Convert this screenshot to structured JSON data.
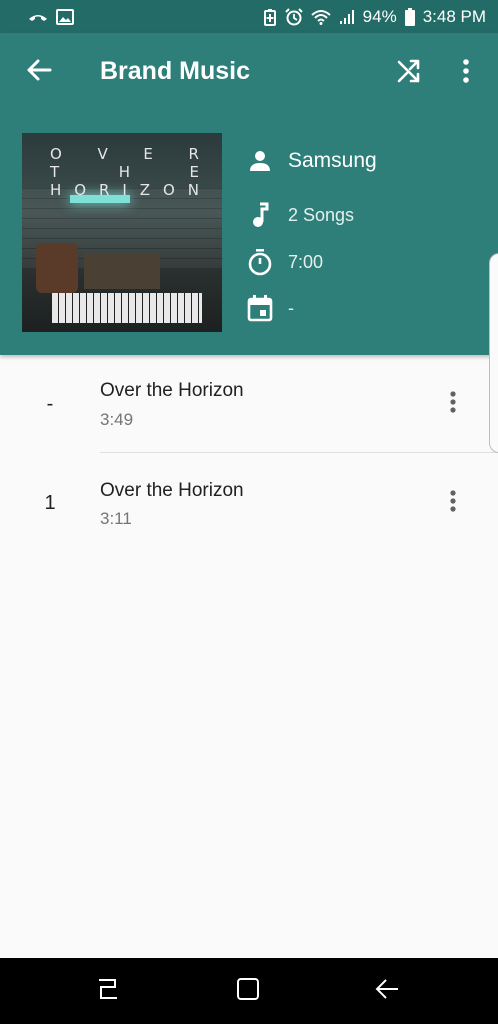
{
  "status_bar": {
    "battery_percent": "94%",
    "time": "3:48 PM",
    "left_icons": [
      "missed-call-icon",
      "image-icon"
    ],
    "right_icons": [
      "battery-saver-icon",
      "alarm-icon",
      "wifi-icon",
      "signal-icon",
      "battery-icon"
    ]
  },
  "app_bar": {
    "title": "Brand Music",
    "back_icon": "arrow-left-icon",
    "shuffle_icon": "shuffle-icon",
    "more_icon": "more-vert-icon"
  },
  "album": {
    "art_text_row1": [
      "O",
      "V",
      "E",
      "R"
    ],
    "art_text_row2": [
      "T",
      "H",
      "E"
    ],
    "art_text_row3": [
      "H",
      "O",
      "R",
      "I",
      "Z",
      "O",
      "N"
    ],
    "artist": "Samsung",
    "songs": "2 Songs",
    "duration": "7:00",
    "year": "-"
  },
  "tracks": [
    {
      "number": "-",
      "title": "Over the Horizon",
      "duration": "3:49"
    },
    {
      "number": "1",
      "title": "Over the Horizon",
      "duration": "3:11"
    }
  ],
  "nav_bar": {
    "recents_icon": "recents-icon",
    "home_icon": "home-icon",
    "back_icon": "back-icon"
  },
  "colors": {
    "header": "#2e7f79",
    "status_bar": "#236b67",
    "background": "#fafafa"
  }
}
